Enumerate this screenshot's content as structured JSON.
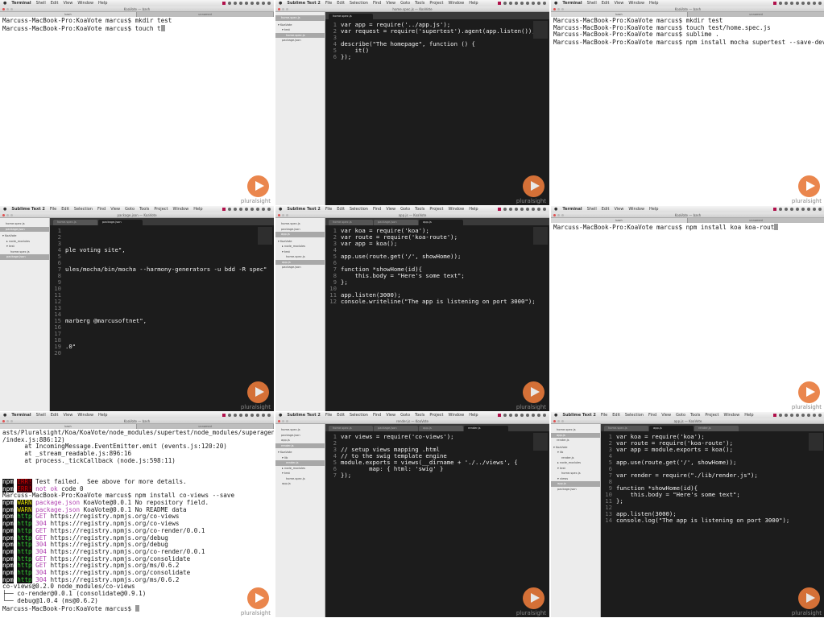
{
  "accent": "#e87a3a",
  "brand": "pluralsight",
  "terminal_menus": [
    "Shell",
    "Edit",
    "View",
    "Window",
    "Help"
  ],
  "sublime_menus": [
    "File",
    "Edit",
    "Selection",
    "Find",
    "View",
    "Goto",
    "Tools",
    "Project",
    "Window",
    "Help"
  ],
  "tiles": [
    {
      "kind": "terminal",
      "app": "Terminal",
      "title": "KoaVote — bash",
      "tabs": [
        "bash",
        "unnamed"
      ],
      "lines": [
        {
          "text": "Marcuss-MacBook-Pro:KoaVote marcus$ mkdir test"
        },
        {
          "text": "Marcuss-MacBook-Pro:KoaVote marcus$ touch t",
          "cursor": true
        }
      ]
    },
    {
      "kind": "editor",
      "app": "Sublime Text 2",
      "title": "home.spec.js — KoaVote",
      "open_files": [
        {
          "name": "home.spec.js",
          "sel": true
        }
      ],
      "folders": [
        {
          "name": "▾ KoaVote",
          "d": 0
        },
        {
          "name": "▾ test",
          "d": 1
        },
        {
          "name": "home.spec.js",
          "d": 2,
          "sel": true
        },
        {
          "name": "package.json",
          "d": 1
        }
      ],
      "tabs": [
        {
          "name": "home.spec.js",
          "active": true
        }
      ],
      "code": [
        "var app = require('../app.js');",
        "var request = require('supertest').agent(app.listen());",
        "",
        "describe(\"The homepage\", function () {",
        "    it()",
        "});"
      ]
    },
    {
      "kind": "terminal",
      "app": "Terminal",
      "title": "KoaVote — bash",
      "tabs": [
        "bash",
        "unnamed"
      ],
      "lines": [
        {
          "text": "Marcuss-MacBook-Pro:KoaVote marcus$ mkdir test"
        },
        {
          "text": "Marcuss-MacBook-Pro:KoaVote marcus$ touch test/home.spec.js"
        },
        {
          "text": "Marcuss-MacBook-Pro:KoaVote marcus$ sublime ."
        },
        {
          "text": "Marcuss-MacBook-Pro:KoaVote marcus$ npm install mocha supertest --save-dev",
          "cursor": true
        }
      ]
    },
    {
      "kind": "editor",
      "app": "Sublime Text 2",
      "title": "package.json — KoaVote",
      "open_files": [
        {
          "name": "home.spec.js"
        },
        {
          "name": "package.json",
          "sel": true
        }
      ],
      "folders": [
        {
          "name": "▾ KoaVote",
          "d": 0
        },
        {
          "name": "▸ node_modules",
          "d": 1
        },
        {
          "name": "▾ test",
          "d": 1
        },
        {
          "name": "home.spec.js",
          "d": 2
        },
        {
          "name": "package.json",
          "d": 1,
          "sel": true
        }
      ],
      "tabs": [
        {
          "name": "home.spec.js"
        },
        {
          "name": "package.json",
          "active": true
        }
      ],
      "code": [
        "",
        "",
        "",
        "ple voting site\",",
        "",
        "",
        "ules/mocha/bin/mocha --harmony-generators -u bdd -R spec\"",
        "",
        "",
        "",
        "",
        "",
        "",
        "",
        "marberg @marcusoftnet\",",
        "",
        "",
        "",
        ".0\"",
        ""
      ]
    },
    {
      "kind": "editor",
      "app": "Sublime Text 2",
      "title": "app.js — KoaVote",
      "open_files": [
        {
          "name": "home.spec.js"
        },
        {
          "name": "package.json"
        },
        {
          "name": "app.js",
          "sel": true
        }
      ],
      "folders": [
        {
          "name": "▾ KoaVote",
          "d": 0
        },
        {
          "name": "▸ node_modules",
          "d": 1
        },
        {
          "name": "▾ test",
          "d": 1
        },
        {
          "name": "home.spec.js",
          "d": 2
        },
        {
          "name": "app.js",
          "d": 1,
          "sel": true
        },
        {
          "name": "package.json",
          "d": 1
        }
      ],
      "tabs": [
        {
          "name": "home.spec.js"
        },
        {
          "name": "package.json"
        },
        {
          "name": "app.js",
          "active": true
        }
      ],
      "code": [
        "var koa = require('koa');",
        "var route = require('koa-route');",
        "var app = koa();",
        "",
        "app.use(route.get('/', showHome));",
        "",
        "function *showHome(id){",
        "    this.body = \"Here's some text\";",
        "};",
        "",
        "app.listen(3000);",
        "console.writeline(\"The app is listening on port 3000\");"
      ]
    },
    {
      "kind": "terminal",
      "app": "Terminal",
      "title": "KoaVote — bash",
      "tabs": [
        "bash",
        "unnamed"
      ],
      "lines": [
        {
          "text": "Marcuss-MacBook-Pro:KoaVote marcus$ npm install koa koa-rout",
          "cursor": true
        }
      ]
    },
    {
      "kind": "terminal",
      "app": "Terminal",
      "title": "KoaVote — bash",
      "tabs": [
        "bash",
        "unnamed"
      ],
      "lines": [
        {
          "text": "asts/Pluralsight/Koa/KoaVote/node_modules/supertest/node_modules/superagent/lib/node"
        },
        {
          "text": "/index.js:886:12)"
        },
        {
          "text": "      at IncomingMessage.EventEmitter.emit (events.js:120:20)"
        },
        {
          "text": "      at _stream_readable.js:896:16"
        },
        {
          "text": "      at process._tickCallback (node.js:598:11)"
        },
        {
          "text": ""
        },
        {
          "text": ""
        },
        {
          "npm": "npm",
          "tag": "ERR!",
          "type": "err",
          "text": " Test failed.  See above for more details."
        },
        {
          "npm": "npm",
          "tag": "ERR!",
          "type": "err",
          "mid": " not ok",
          "text": " code 0"
        },
        {
          "text": "Marcuss-MacBook-Pro:KoaVote marcus$ npm install co-views --save"
        },
        {
          "npm": "npm",
          "tag": "WARN",
          "type": "warn",
          "mid": " package.json",
          "text": " KoaVote@0.0.1 No repository field."
        },
        {
          "npm": "npm",
          "tag": "WARN",
          "type": "warn",
          "mid": " package.json",
          "text": " KoaVote@0.0.1 No README data"
        },
        {
          "npm": "npm",
          "tag": "http",
          "type": "http",
          "mid": " GET",
          "text": " https://registry.npmjs.org/co-views"
        },
        {
          "npm": "npm",
          "tag": "http",
          "type": "http",
          "mid": " 304",
          "text": " https://registry.npmjs.org/co-views"
        },
        {
          "npm": "npm",
          "tag": "http",
          "type": "http",
          "mid": " GET",
          "text": " https://registry.npmjs.org/co-render/0.0.1"
        },
        {
          "npm": "npm",
          "tag": "http",
          "type": "http",
          "mid": " GET",
          "text": " https://registry.npmjs.org/debug"
        },
        {
          "npm": "npm",
          "tag": "http",
          "type": "http",
          "mid": " 304",
          "text": " https://registry.npmjs.org/debug"
        },
        {
          "npm": "npm",
          "tag": "http",
          "type": "http",
          "mid": " 304",
          "text": " https://registry.npmjs.org/co-render/0.0.1"
        },
        {
          "npm": "npm",
          "tag": "http",
          "type": "http",
          "mid": " GET",
          "text": " https://registry.npmjs.org/consolidate"
        },
        {
          "npm": "npm",
          "tag": "http",
          "type": "http",
          "mid": " GET",
          "text": " https://registry.npmjs.org/ms/0.6.2"
        },
        {
          "npm": "npm",
          "tag": "http",
          "type": "http",
          "mid": " 304",
          "text": " https://registry.npmjs.org/consolidate"
        },
        {
          "npm": "npm",
          "tag": "http",
          "type": "http",
          "mid": " 304",
          "text": " https://registry.npmjs.org/ms/0.6.2"
        },
        {
          "text": "co-views@0.2.0 node_modules/co-views"
        },
        {
          "text": "├── co-render@0.0.1 (consolidate@0.9.1)"
        },
        {
          "text": "└── debug@1.0.4 (ms@0.6.2)"
        },
        {
          "text": "Marcuss-MacBook-Pro:KoaVote marcus$ ",
          "cursor": true
        }
      ]
    },
    {
      "kind": "editor",
      "app": "Sublime Text 2",
      "title": "render.js — KoaVote",
      "open_files": [
        {
          "name": "home.spec.js"
        },
        {
          "name": "package.json"
        },
        {
          "name": "app.js"
        },
        {
          "name": "render.js",
          "sel": true
        }
      ],
      "folders": [
        {
          "name": "▾ KoaVote",
          "d": 0
        },
        {
          "name": "▾ lib",
          "d": 1
        },
        {
          "name": "render.js",
          "d": 2,
          "sel": true
        },
        {
          "name": "▸ node_modules",
          "d": 1
        },
        {
          "name": "▾ test",
          "d": 1
        },
        {
          "name": "home.spec.js",
          "d": 2
        },
        {
          "name": "app.js",
          "d": 1
        }
      ],
      "tabs": [
        {
          "name": "home.spec.js"
        },
        {
          "name": "package.json"
        },
        {
          "name": "app.js"
        },
        {
          "name": "render.js",
          "active": true
        }
      ],
      "code": [
        "var views = require('co-views');",
        "",
        "// setup views mapping .html",
        "// to the swig template engine",
        "module.exports = views(__dirname + './../views', {",
        "        map: { html: 'swig' }",
        "});"
      ]
    },
    {
      "kind": "editor",
      "app": "Sublime Text 2",
      "title": "app.js — KoaVote",
      "open_files": [
        {
          "name": "home.spec.js"
        },
        {
          "name": "app.js",
          "sel": true
        },
        {
          "name": "render.js"
        }
      ],
      "folders": [
        {
          "name": "▾ KoaVote",
          "d": 0
        },
        {
          "name": "▾ lib",
          "d": 1
        },
        {
          "name": "render.js",
          "d": 2
        },
        {
          "name": "▸ node_modules",
          "d": 1
        },
        {
          "name": "▾ test",
          "d": 1
        },
        {
          "name": "home.spec.js",
          "d": 2
        },
        {
          "name": "▾ views",
          "d": 1
        },
        {
          "name": "app.js",
          "d": 1,
          "sel": true
        },
        {
          "name": "package.json",
          "d": 1
        }
      ],
      "tabs": [
        {
          "name": "home.spec.js"
        },
        {
          "name": "app.js",
          "active": true
        },
        {
          "name": "render.js"
        }
      ],
      "code": [
        "var koa = require('koa');",
        "var route = require('koa-route');",
        "var app = module.exports = koa();",
        "",
        "app.use(route.get('/', showHome));",
        "",
        "var render = require(\"./lib/render.js\");",
        "",
        "function *showHome(id){",
        "    this.body = \"Here's some text\";",
        "};",
        "",
        "app.listen(3000);",
        "console.log(\"The app is listening on port 3000\");"
      ]
    }
  ]
}
